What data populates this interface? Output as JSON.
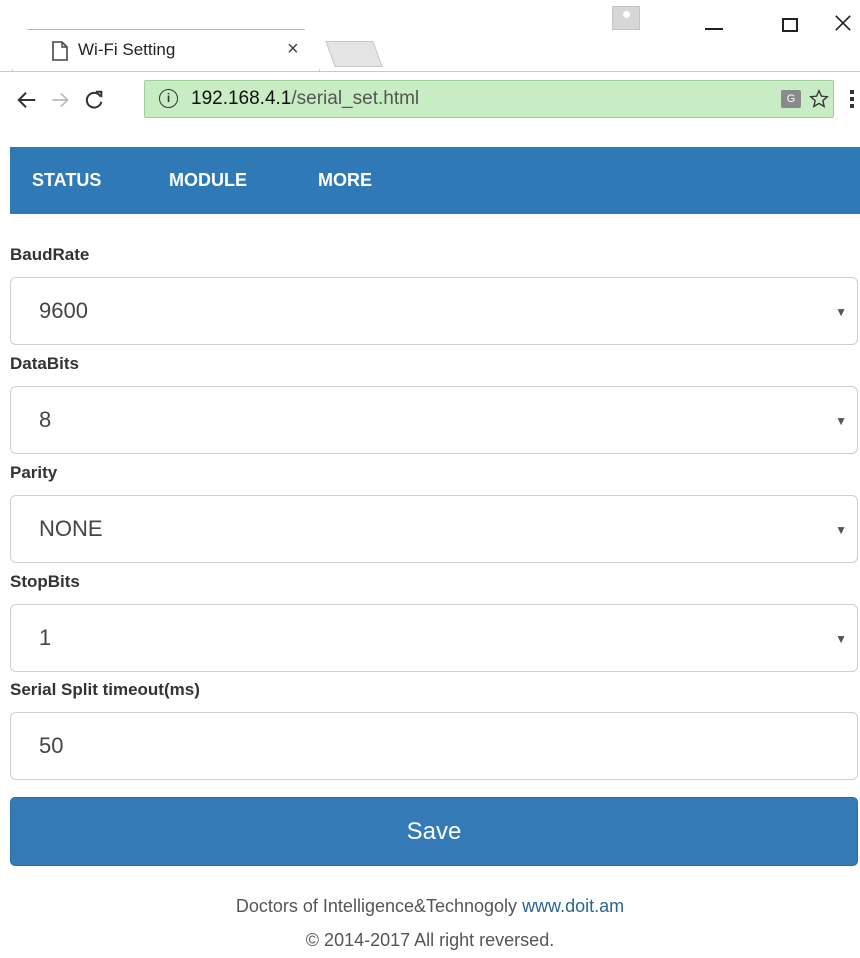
{
  "browser": {
    "tab_title": "Wi-Fi Setting",
    "tab_close": "×",
    "url_host": "192.168.4.1",
    "url_path": "/serial_set.html",
    "info_glyph": "i",
    "translate_glyph": "G",
    "icons": [
      "page-icon",
      "back-icon",
      "forward-icon",
      "reload-icon",
      "info-icon",
      "translate-icon",
      "star-icon",
      "menu-icon",
      "profile-icon",
      "minimize-icon",
      "maximize-icon",
      "close-icon"
    ]
  },
  "nav": {
    "items": [
      {
        "label": "STATUS"
      },
      {
        "label": "MODULE"
      },
      {
        "label": "MORE"
      }
    ],
    "color": "#2f7ab6"
  },
  "form": {
    "fields": [
      {
        "label": "BaudRate",
        "value": "9600",
        "type": "select"
      },
      {
        "label": "DataBits",
        "value": "8",
        "type": "select"
      },
      {
        "label": "Parity",
        "value": "NONE",
        "type": "select"
      },
      {
        "label": "StopBits",
        "value": "1",
        "type": "select"
      },
      {
        "label": "Serial Split timeout(ms)",
        "value": "50",
        "type": "input"
      }
    ],
    "save_label": "Save",
    "save_color": "#337ab7"
  },
  "footer": {
    "line1_text": "Doctors of Intelligence&Technogoly ",
    "line1_link": "www.doit.am",
    "line2": "© 2014-2017 All right reversed."
  }
}
